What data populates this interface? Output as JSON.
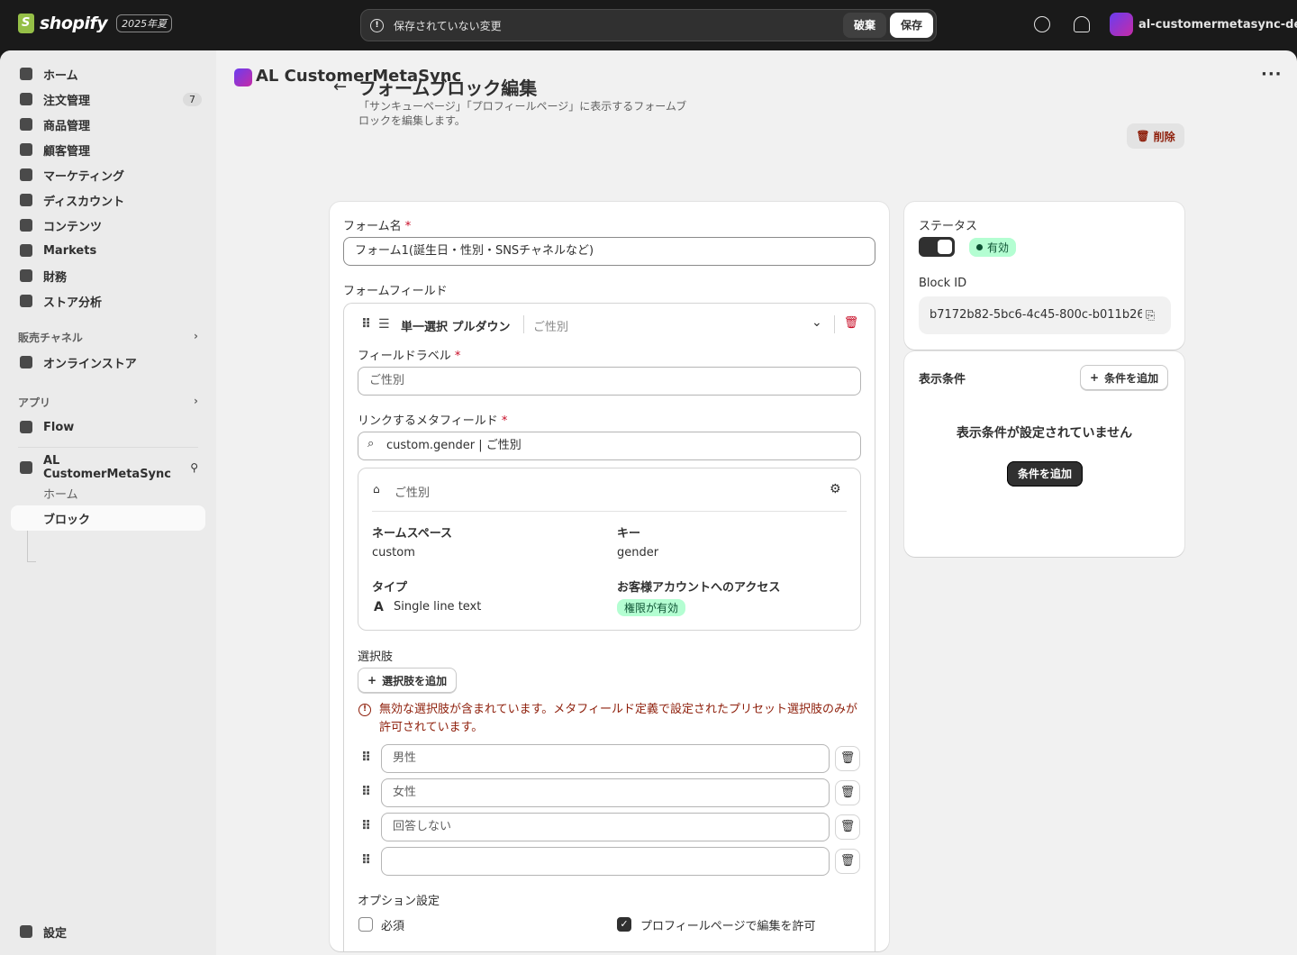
{
  "topbar": {
    "logo_text": "shopify",
    "edition": "2025年夏",
    "unsaved_message": "保存されていない変更",
    "discard_label": "破棄",
    "save_label": "保存",
    "store_name": "al-customermetasync-de..."
  },
  "sidebar": {
    "items": [
      {
        "label": "ホーム"
      },
      {
        "label": "注文管理",
        "badge": "7"
      },
      {
        "label": "商品管理"
      },
      {
        "label": "顧客管理"
      },
      {
        "label": "マーケティング"
      },
      {
        "label": "ディスカウント"
      },
      {
        "label": "コンテンツ"
      },
      {
        "label": "Markets"
      },
      {
        "label": "財務"
      },
      {
        "label": "ストア分析"
      }
    ],
    "sales_channels_label": "販売チャネル",
    "online_store_label": "オンラインストア",
    "apps_label": "アプリ",
    "flow_label": "Flow",
    "app_name": "AL CustomerMetaSync",
    "app_sub_home": "ホーム",
    "app_sub_blocks": "ブロック",
    "settings_label": "設定"
  },
  "header": {
    "app_title": "AL CustomerMetaSync"
  },
  "page": {
    "title": "フォームブロック編集",
    "subtitle": "「サンキューページ」「プロフィールページ」に表示するフォームブロックを編集します。",
    "delete_label": "削除"
  },
  "form": {
    "name_label": "フォーム名",
    "name_value": "フォーム1(誕生日・性別・SNSチャネルなど)",
    "fields_label": "フォームフィールド",
    "field": {
      "type": "単一選択 プルダウン",
      "name": "ご性別",
      "label_label": "フィールドラベル",
      "label_value": "ご性別",
      "metafield_label": "リンクするメタフィールド",
      "metafield_value": "custom.gender | ご性別",
      "meta_card": {
        "title": "ご性別",
        "namespace_label": "ネームスペース",
        "namespace_value": "custom",
        "key_label": "キー",
        "key_value": "gender",
        "type_label": "タイプ",
        "type_value": "Single line text",
        "access_label": "お客様アカウントへのアクセス",
        "access_value": "権限が有効"
      },
      "choices_label": "選択肢",
      "add_choice_label": "選択肢を追加",
      "error_message": "無効な選択肢が含まれています。メタフィールド定義で設定されたプリセット選択肢のみが許可されています。",
      "choices": [
        "男性",
        "女性",
        "回答しない",
        ""
      ],
      "options_label": "オプション設定",
      "required_label": "必須",
      "required_checked": false,
      "editable_label": "プロフィールページで編集を許可",
      "editable_checked": true
    }
  },
  "side": {
    "status_label": "ステータス",
    "status_value": "有効",
    "block_id_label": "Block ID",
    "block_id_value": "b7172b82-5bc6-4c45-800c-b011b26",
    "conditions_title": "表示条件",
    "add_condition_label": "条件を追加",
    "empty_message": "表示条件が設定されていません",
    "add_condition_primary": "条件を追加"
  },
  "colors": {
    "accent": "#303030",
    "success_bg": "#b4fed2",
    "critical": "#8e1f0b",
    "brand": "#95bf47"
  }
}
